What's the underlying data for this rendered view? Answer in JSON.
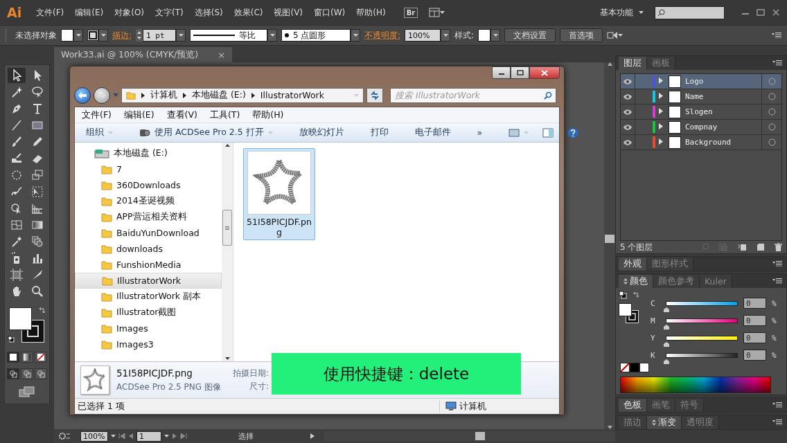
{
  "app": {
    "logo": "Ai",
    "menus": [
      "文件(F)",
      "编辑(E)",
      "对象(O)",
      "文字(T)",
      "选择(S)",
      "效果(C)",
      "视图(V)",
      "窗口(W)",
      "帮助(H)"
    ],
    "bridge": "Br",
    "workspace": "基本功能"
  },
  "control_bar": {
    "selection": "未选择对象",
    "stroke_label": "描边:",
    "stroke_weight": "1 pt",
    "stroke_profile": "等比",
    "brush": "5 点圆形",
    "opacity_label": "不透明度:",
    "opacity": "100%",
    "style_label": "样式:",
    "buttons": [
      "文档设置",
      "首选项"
    ]
  },
  "document_tab": {
    "title": "Work33.ai @ 100% (CMYK/预览)",
    "close": "×"
  },
  "toolbox": {
    "tools": [
      {
        "selected": true
      },
      {
        "selected": false
      },
      {
        "selected": false
      },
      {
        "selected": false
      },
      {
        "selected": false
      },
      {
        "selected": false
      },
      {
        "selected": false
      },
      {
        "selected": false
      },
      {
        "selected": false
      },
      {
        "selected": false
      },
      {
        "selected": false
      },
      {
        "selected": false
      },
      {
        "selected": false
      },
      {
        "selected": false
      },
      {
        "selected": false
      },
      {
        "selected": false
      },
      {
        "selected": false
      },
      {
        "selected": false
      },
      {
        "selected": false
      },
      {
        "selected": false
      },
      {
        "selected": false
      },
      {
        "selected": false
      },
      {
        "selected": false
      },
      {
        "selected": false
      },
      {
        "selected": false
      },
      {
        "selected": false
      },
      {
        "selected": false
      },
      {
        "selected": false
      }
    ],
    "fill_modes": [
      {
        "selected": true
      },
      {
        "selected": false
      },
      {
        "selected": false
      }
    ],
    "draw_modes": [
      {
        "selected": true
      },
      {
        "selected": false
      },
      {
        "selected": false
      }
    ]
  },
  "explorer": {
    "breadcrumb": [
      "计算机",
      "本地磁盘 (E:)",
      "IllustratorWork"
    ],
    "search": {
      "placeholder": "搜索 IllustratorWork"
    },
    "menus": [
      "文件(F)",
      "编辑(E)",
      "查看(V)",
      "工具(T)",
      "帮助(H)"
    ],
    "commands": [
      {
        "label": "组织",
        "kind": "menu"
      },
      {
        "label": "使用 ACDSee Pro 2.5 打开",
        "kind": "app"
      },
      {
        "label": "放映幻灯片",
        "kind": "plain"
      },
      {
        "label": "打印",
        "kind": "plain"
      },
      {
        "label": "电子邮件",
        "kind": "plain"
      },
      {
        "label": "»",
        "kind": "plain"
      }
    ],
    "tree": [
      {
        "label": "本地磁盘 (E:)",
        "kind": "drive",
        "selected": false,
        "children": [
          {
            "label": "7",
            "kind": "folder",
            "selected": false
          },
          {
            "label": "360Downloads",
            "kind": "folder",
            "selected": false
          },
          {
            "label": "2014圣诞视频",
            "kind": "folder",
            "selected": false
          },
          {
            "label": "APP营运相关资料",
            "kind": "folder",
            "selected": false
          },
          {
            "label": "BaiduYunDownload",
            "kind": "folder",
            "selected": false
          },
          {
            "label": "downloads",
            "kind": "folder",
            "selected": false
          },
          {
            "label": "FunshionMedia",
            "kind": "folder",
            "selected": false
          },
          {
            "label": "IllustratorWork",
            "kind": "folder",
            "selected": true
          },
          {
            "label": "IllustratorWork 副本",
            "kind": "folder",
            "selected": false
          },
          {
            "label": "Illustrator截图",
            "kind": "folder",
            "selected": false
          },
          {
            "label": "Images",
            "kind": "folder",
            "selected": false
          },
          {
            "label": "Images3",
            "kind": "folder",
            "selected": false
          }
        ]
      }
    ],
    "files": [
      {
        "name": "51I58PICJDF.png",
        "selected": true
      }
    ],
    "details": {
      "name": "51I58PICJDF.png",
      "type": "ACDSee Pro 2.5 PNG 图像",
      "fields": [
        "拍摄日期:",
        "尺寸:"
      ]
    },
    "status": "已选择 1 项",
    "location": "计算机"
  },
  "caption": "使用快捷键：delete",
  "layers_panel": {
    "tabs": [
      {
        "label": "图层",
        "selected": true,
        "collapsible": false
      },
      {
        "label": "画板",
        "selected": false,
        "collapsible": false
      }
    ],
    "layers": [
      {
        "name": "Logo",
        "color": "#4a56d8",
        "selected": true,
        "visible": true
      },
      {
        "name": "Name",
        "color": "#18c8dc",
        "selected": false,
        "visible": true
      },
      {
        "name": "Slogen",
        "color": "#d040d0",
        "selected": false,
        "visible": true
      },
      {
        "name": "Compnay",
        "color": "#20c040",
        "selected": false,
        "visible": true
      },
      {
        "name": "Background",
        "color": "#e05030",
        "selected": false,
        "visible": true
      }
    ],
    "count": "5 个图层"
  },
  "appearance_panel": {
    "tabs": [
      {
        "label": "外观",
        "selected": true,
        "collapsible": false
      },
      {
        "label": "图形样式",
        "selected": false,
        "collapsible": false
      }
    ]
  },
  "color_panel": {
    "tabs": [
      {
        "label": "颜色",
        "selected": true,
        "collapsible": true
      },
      {
        "label": "颜色参考",
        "selected": false,
        "collapsible": false
      },
      {
        "label": "Kuler",
        "selected": false,
        "collapsible": false
      }
    ],
    "channels": [
      {
        "name": "C",
        "level": 0,
        "value": "0",
        "unit": "%"
      },
      {
        "name": "M",
        "level": 0,
        "value": "0",
        "unit": "%"
      },
      {
        "name": "Y",
        "level": 0,
        "value": "0",
        "unit": "%"
      },
      {
        "name": "K",
        "level": 0,
        "value": "0",
        "unit": "%"
      }
    ]
  },
  "swatches_panel": {
    "tabs": [
      {
        "label": "色板",
        "selected": true,
        "collapsible": false
      },
      {
        "label": "画笔",
        "selected": false,
        "collapsible": false
      },
      {
        "label": "符号",
        "selected": false,
        "collapsible": false
      }
    ]
  },
  "stroke_panel": {
    "tabs": [
      {
        "label": "描边",
        "selected": false,
        "collapsible": false
      },
      {
        "label": "渐变",
        "selected": true,
        "collapsible": true
      },
      {
        "label": "透明度",
        "selected": false,
        "collapsible": false
      }
    ]
  },
  "status_bar": {
    "zoom": "100%",
    "page": "1",
    "tool": "选择"
  }
}
